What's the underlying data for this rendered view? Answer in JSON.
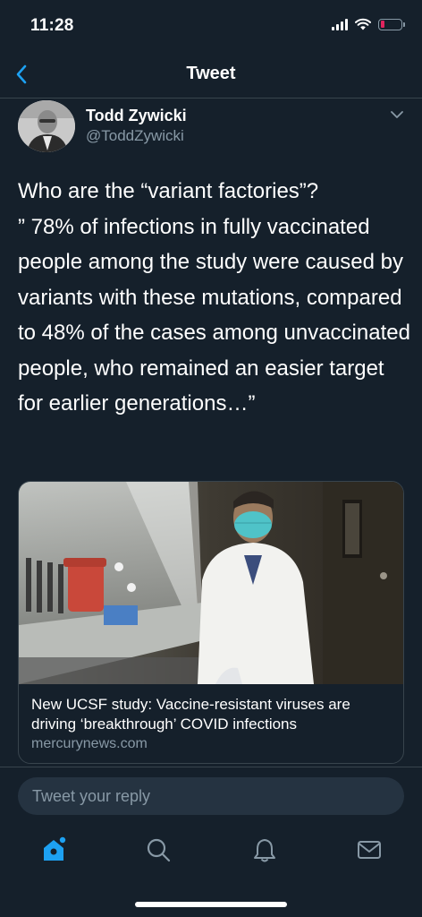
{
  "status_bar": {
    "time": "11:28"
  },
  "nav": {
    "title": "Tweet"
  },
  "tweet": {
    "author_name": "Todd Zywicki",
    "author_handle": "@ToddZywicki",
    "text": "Who are the “variant factories”?\n” 78% of infections in fully vaccinated people among the study were caused by variants with these mutations, compared to 48% of the cases among unvaccinated people, who remained an easier target for earlier generations…”"
  },
  "link_card": {
    "title": "New UCSF study: Vaccine-resistant viruses are driving ‘breakthrough’ COVID infections",
    "domain": "mercurynews.com"
  },
  "reply": {
    "placeholder": "Tweet your reply"
  },
  "tabs": [
    {
      "icon": "home-icon",
      "active": true
    },
    {
      "icon": "search-icon",
      "active": false
    },
    {
      "icon": "bell-icon",
      "active": false
    },
    {
      "icon": "mail-icon",
      "active": false
    }
  ],
  "colors": {
    "background": "#15202b",
    "accent": "#1da1f2",
    "secondary_text": "#8899a6",
    "divider": "#38444d",
    "battery_low": "#e0245e"
  }
}
